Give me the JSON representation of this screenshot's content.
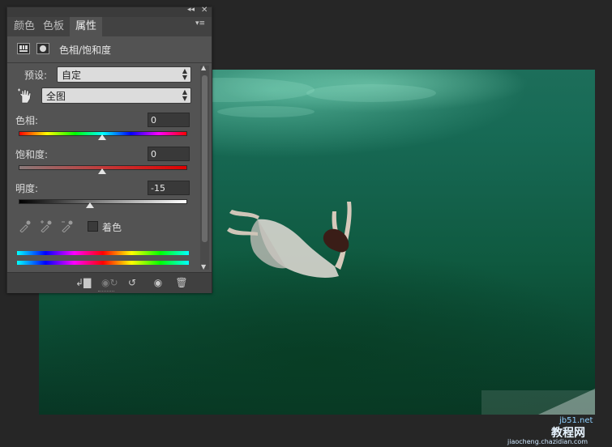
{
  "panel": {
    "tabs": [
      {
        "label": "颜色"
      },
      {
        "label": "色板"
      },
      {
        "label": "属性"
      }
    ],
    "active_tab": "属性",
    "title": "色相/饱和度",
    "preset_label": "预设:",
    "preset_value": "自定",
    "channel_value": "全图",
    "hue": {
      "label": "色相:",
      "value": "0",
      "level": 0.5
    },
    "saturation": {
      "label": "饱和度:",
      "value": "0",
      "level": 0.5
    },
    "lightness": {
      "label": "明度:",
      "value": "-15",
      "level": 0.425
    },
    "colorize_label": "着色"
  },
  "watermark": {
    "line1": "jb51.net",
    "line2": "教程网",
    "line3": "jiaocheng.chazidian.com"
  },
  "colors": {
    "panel_bg": "#535353",
    "app_bg": "#262626",
    "canvas_water": "#176a55"
  }
}
